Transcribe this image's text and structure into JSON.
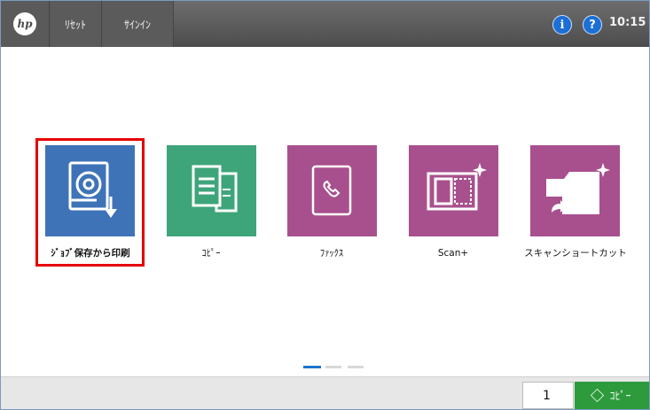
{
  "topbar": {
    "reset_label": "ﾘｾｯﾄ",
    "signin_label": "ｻｲﾝｲﾝ",
    "logo_text": "hp",
    "info_glyph": "i",
    "help_glyph": "?",
    "time": "10:15"
  },
  "tiles": [
    {
      "label": "ｼﾞｮﾌﾞ保存から印刷",
      "icon": "stored-job-disk-icon",
      "color": "#3f73b8",
      "selected": true
    },
    {
      "label": "ｺﾋﾟｰ",
      "icon": "copy-icon",
      "color": "#3ea57a"
    },
    {
      "label": "ﾌｧｯｸｽ",
      "icon": "fax-icon",
      "color": "#a8508e"
    },
    {
      "label": "Scan+",
      "icon": "scan-icon",
      "color": "#a8508e"
    },
    {
      "label": "スキャンショートカット",
      "icon": "scan-shortcut-folder-icon",
      "color": "#a8508e"
    }
  ],
  "pagination": {
    "pages": 3,
    "current": 1
  },
  "bottombar": {
    "copies_value": "1",
    "copy_button_label": "ｺﾋﾟｰ"
  },
  "colors": {
    "accent": "#1a74d1",
    "go": "#2d9a3c",
    "highlight": "#e60000"
  }
}
